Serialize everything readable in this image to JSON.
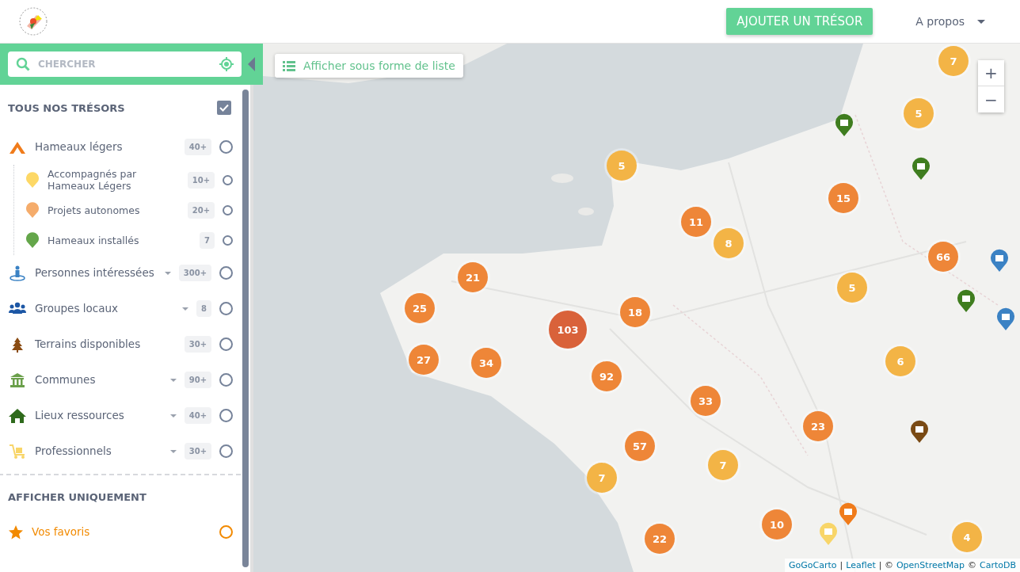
{
  "header": {
    "add_button": "AJOUTER UN TRÉSOR",
    "about_menu": "A propos"
  },
  "search": {
    "placeholder": "CHERCHER"
  },
  "filters": {
    "title": "TOUS NOS TRÉSORS",
    "all_checked": true,
    "categories": [
      {
        "label": "Hameaux légers",
        "count": "40+",
        "checked": false,
        "dropdown": false,
        "children": [
          {
            "label": "Accompagnés par Hameaux Légers",
            "count": "10+",
            "checked": false,
            "color": "#fdd866"
          },
          {
            "label": "Projets autonomes",
            "count": "20+",
            "checked": false,
            "color": "#f5ac6b"
          },
          {
            "label": "Hameaux installés",
            "count": "7",
            "checked": false,
            "color": "#64a64a"
          }
        ]
      },
      {
        "label": "Personnes intéressées",
        "count": "300+",
        "checked": false,
        "dropdown": true
      },
      {
        "label": "Groupes locaux",
        "count": "8",
        "checked": false,
        "dropdown": true
      },
      {
        "label": "Terrains disponibles",
        "count": "30+",
        "checked": false,
        "dropdown": false
      },
      {
        "label": "Communes",
        "count": "90+",
        "checked": false,
        "dropdown": true
      },
      {
        "label": "Lieux ressources",
        "count": "40+",
        "checked": false,
        "dropdown": true
      },
      {
        "label": "Professionnels",
        "count": "30+",
        "checked": false,
        "dropdown": true
      }
    ]
  },
  "only": {
    "title": "AFFICHER UNIQUEMENT",
    "favorites": {
      "label": "Vos favoris",
      "checked": false
    }
  },
  "map": {
    "list_button": "Afficher sous forme de liste",
    "zoom": [
      "+",
      "−"
    ],
    "clusters": [
      {
        "count": "7",
        "color": "#f3b446"
      },
      {
        "count": "5",
        "color": "#f3b446"
      },
      {
        "count": "5",
        "color": "#f3b446"
      },
      {
        "count": "15",
        "color": "#ee8638"
      },
      {
        "count": "11",
        "color": "#ee8638"
      },
      {
        "count": "8",
        "color": "#f3b446"
      },
      {
        "count": "66",
        "color": "#ee8638"
      },
      {
        "count": "21",
        "color": "#ee8638"
      },
      {
        "count": "25",
        "color": "#ee8638"
      },
      {
        "count": "5",
        "color": "#f3b446"
      },
      {
        "count": "18",
        "color": "#ee8638"
      },
      {
        "count": "103",
        "color": "#d9623a"
      },
      {
        "count": "27",
        "color": "#ee8638"
      },
      {
        "count": "34",
        "color": "#ee8638"
      },
      {
        "count": "6",
        "color": "#f3b446"
      },
      {
        "count": "92",
        "color": "#ee8638"
      },
      {
        "count": "33",
        "color": "#ee8638"
      },
      {
        "count": "23",
        "color": "#ee8638"
      },
      {
        "count": "57",
        "color": "#ee8638"
      },
      {
        "count": "7",
        "color": "#f3b446"
      },
      {
        "count": "7",
        "color": "#f3b446"
      },
      {
        "count": "10",
        "color": "#ee8638"
      },
      {
        "count": "22",
        "color": "#ee8638"
      },
      {
        "count": "4",
        "color": "#f3b446"
      }
    ],
    "attribution": [
      {
        "kind": "link",
        "text": "GoGoCarto"
      },
      {
        "kind": "plain",
        "text": "|"
      },
      {
        "kind": "link",
        "text": "Leaflet"
      },
      {
        "kind": "plain",
        "text": "| ©"
      },
      {
        "kind": "link",
        "text": "OpenStreetMap"
      },
      {
        "kind": "plain",
        "text": "©"
      },
      {
        "kind": "link",
        "text": "CartoDB"
      }
    ]
  }
}
